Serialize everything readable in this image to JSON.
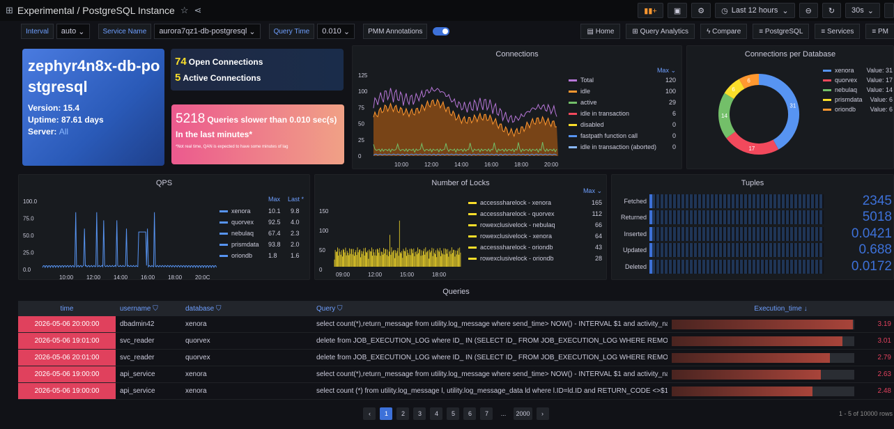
{
  "header": {
    "title": "Experimental / PostgreSQL Instance",
    "time_range": "Last 12 hours",
    "refresh": "30s"
  },
  "vars": [
    {
      "label": "Interval",
      "value": "auto"
    },
    {
      "label": "Service Name",
      "value": "aurora7qz1-db-postgresql"
    },
    {
      "label": "Query Time",
      "value": "0.010"
    }
  ],
  "annotations_label": "PMM Annotations",
  "nav_links": [
    "Home",
    "Query Analytics",
    "Compare",
    "PostgreSQL",
    "Services",
    "PM"
  ],
  "info": {
    "name": "zephyr4n8x-db-postgresql",
    "version": "Version: 15.4",
    "uptime": "Uptime: 87.61 days",
    "server_label": "Server:",
    "server_value": "All"
  },
  "open_connections": {
    "num": "74",
    "label": "Open Connections"
  },
  "active_connections": {
    "num": "5",
    "label": "Active Connections"
  },
  "slow": {
    "num": "5218",
    "label": "Queries slower than 0.010 sec(s)",
    "sub": "In the last minutes*",
    "note": "*Not real time, QAN is expected to have some minutes of lag"
  },
  "connections_panel": {
    "title": "Connections",
    "max_header": "Max",
    "legend": [
      {
        "name": "Total",
        "value": "120",
        "color": "#b877d9"
      },
      {
        "name": "idle",
        "value": "100",
        "color": "#ff9830"
      },
      {
        "name": "active",
        "value": "29",
        "color": "#73bf69"
      },
      {
        "name": "idle in transaction",
        "value": "6",
        "color": "#f2495c"
      },
      {
        "name": "disabled",
        "value": "0",
        "color": "#fade2a"
      },
      {
        "name": "fastpath function call",
        "value": "0",
        "color": "#5794f2"
      },
      {
        "name": "idle in transaction (aborted)",
        "value": "0",
        "color": "#8ab8ff"
      }
    ],
    "yticks": [
      "125",
      "100",
      "75",
      "50",
      "25",
      "0"
    ],
    "xticks": [
      "10:00",
      "12:00",
      "14:00",
      "16:00",
      "18:00",
      "20:00"
    ]
  },
  "cpd": {
    "title": "Connections per Database",
    "legend": [
      {
        "name": "xenora",
        "value": "Value: 31",
        "color": "#5794f2"
      },
      {
        "name": "quorvex",
        "value": "Value: 17",
        "color": "#f2495c"
      },
      {
        "name": "nebulaq",
        "value": "Value: 14",
        "color": "#73bf69"
      },
      {
        "name": "prismdata",
        "value": "Value: 6",
        "color": "#fade2a"
      },
      {
        "name": "oriondb",
        "value": "Value: 6",
        "color": "#ff9830"
      }
    ],
    "labels": [
      "31",
      "17",
      "14",
      "6",
      "6"
    ]
  },
  "qps": {
    "title": "QPS",
    "col_max": "Max",
    "col_last": "Last *",
    "rows": [
      {
        "name": "xenora",
        "max": "10.1",
        "last": "9.8",
        "color": "#5794f2"
      },
      {
        "name": "quorvex",
        "max": "92.5",
        "last": "4.0",
        "color": "#5794f2"
      },
      {
        "name": "nebulaq",
        "max": "67.4",
        "last": "2.3",
        "color": "#5794f2"
      },
      {
        "name": "prismdata",
        "max": "93.8",
        "last": "2.0",
        "color": "#5794f2"
      },
      {
        "name": "oriondb",
        "max": "1.8",
        "last": "1.6",
        "color": "#5794f2"
      }
    ],
    "yticks": [
      "100.0",
      "75.0",
      "50.0",
      "25.0",
      "0.0"
    ],
    "xticks": [
      "10:00",
      "12:00",
      "14:00",
      "16:00",
      "18:00",
      "20:0C"
    ]
  },
  "locks": {
    "title": "Number of Locks",
    "max_header": "Max",
    "rows": [
      {
        "name": "accesssharelock - xenora",
        "max": "165"
      },
      {
        "name": "accesssharelock - quorvex",
        "max": "112"
      },
      {
        "name": "rowexclusivelock - nebulaq",
        "max": "66"
      },
      {
        "name": "rowexclusivelock - xenora",
        "max": "64"
      },
      {
        "name": "accesssharelock - oriondb",
        "max": "43"
      },
      {
        "name": "rowexclusivelock - oriondb",
        "max": "28"
      }
    ],
    "yticks": [
      "150",
      "100",
      "50",
      "0"
    ],
    "xticks": [
      "09:00",
      "12:00",
      "15:00",
      "18:00"
    ]
  },
  "tuples": {
    "title": "Tuples",
    "rows": [
      {
        "label": "Fetched",
        "value": "2345"
      },
      {
        "label": "Returned",
        "value": "5018"
      },
      {
        "label": "Inserted",
        "value": "0.0421"
      },
      {
        "label": "Updated",
        "value": "0.688"
      },
      {
        "label": "Deleted",
        "value": "0.0172"
      }
    ]
  },
  "queries": {
    "title": "Queries",
    "headers": [
      "time",
      "username",
      "database",
      "Query",
      "Execution_time"
    ],
    "rows": [
      {
        "time": "2026-05-06 20:00:00",
        "user": "dbadmin42",
        "db": "xenora",
        "query": "select count(*),return_message from utility.log_message where send_time> NOW() - INTERVAL $1 and activity_na...",
        "exec": "3.19"
      },
      {
        "time": "2026-05-06 19:01:00",
        "user": "svc_reader",
        "db": "quorvex",
        "query": "delete from JOB_EXECUTION_LOG where ID_ IN (SELECT ID_ FROM JOB_EXECUTION_LOG WHERE REMOVAL_TI...",
        "exec": "3.01"
      },
      {
        "time": "2026-05-06 20:01:00",
        "user": "svc_reader",
        "db": "quorvex",
        "query": "delete from JOB_EXECUTION_LOG where ID_ IN (SELECT ID_ FROM JOB_EXECUTION_LOG WHERE REMOVAL_TI...",
        "exec": "2.79"
      },
      {
        "time": "2026-05-06 19:00:00",
        "user": "api_service",
        "db": "xenora",
        "query": "select count(*),return_message from utility.log_message where send_time> NOW() - INTERVAL $1 and activity_na...",
        "exec": "2.63"
      },
      {
        "time": "2026-05-06 19:00:00",
        "user": "api_service",
        "db": "xenora",
        "query": "select count (*) from utility.log_message l, utility.log_message_data ld where l.ID=ld.ID and RETURN_CODE <>$1 ...",
        "exec": "2.48"
      }
    ],
    "pages": [
      "1",
      "2",
      "3",
      "4",
      "5",
      "6",
      "7",
      "...",
      "2000"
    ],
    "summary": "1 - 5 of 10000 rows"
  }
}
